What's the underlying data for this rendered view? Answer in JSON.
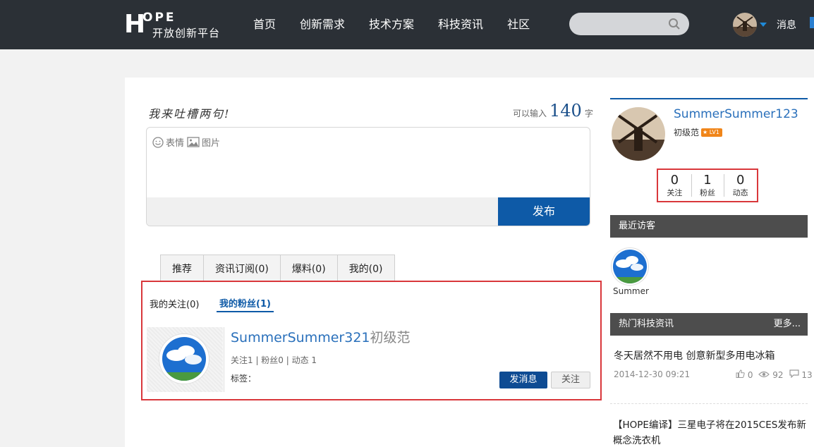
{
  "header": {
    "logo_letters": "OPE",
    "logo_h": "H",
    "logo_subtitle": "开放创新平台",
    "nav": [
      "首页",
      "创新需求",
      "技术方案",
      "科技资讯",
      "社区"
    ],
    "search_placeholder": "",
    "messages_label": "消息"
  },
  "composer": {
    "slogan": "我来吐槽两句!",
    "counter_prefix": "可以输入",
    "counter_value": "140",
    "counter_suffix": "字",
    "emoji_label": "表情",
    "image_label": "图片",
    "publish_label": "发布"
  },
  "tabs": [
    "推荐",
    "资讯订阅(0)",
    "爆料(0)",
    "我的(0)"
  ],
  "subtabs": {
    "following": "我的关注(0)",
    "fans": "我的粉丝(1)"
  },
  "fan_card": {
    "name": "SummerSummer321",
    "level": "初级范",
    "stats": "关注1 | 粉丝0 | 动态 1",
    "tags_label": "标签：",
    "message_button": "发消息",
    "follow_button": "关注"
  },
  "profile": {
    "name": "SummerSummer123",
    "level": "初级范",
    "level_badge": "LV1",
    "stats": [
      {
        "value": "0",
        "label": "关注"
      },
      {
        "value": "1",
        "label": "粉丝"
      },
      {
        "value": "0",
        "label": "动态"
      }
    ]
  },
  "recent_visitors": {
    "title": "最近访客",
    "items": [
      {
        "name": "Summer"
      }
    ]
  },
  "hot_news": {
    "title": "热门科技资讯",
    "more": "更多...",
    "items": [
      {
        "title": "冬天居然不用电 创意新型多用电冰箱",
        "date": "2014-12-30 09:21",
        "likes": "0",
        "views": "92",
        "comments": "13"
      },
      {
        "title": "【HOPE编译】三星电子将在2015CES发布新概念洗衣机"
      }
    ]
  },
  "colors": {
    "header_bg": "#2b3036",
    "brand_blue": "#0e5aa7",
    "highlight_red": "#d9373b",
    "side_bar_bg": "#4d4d4d"
  }
}
